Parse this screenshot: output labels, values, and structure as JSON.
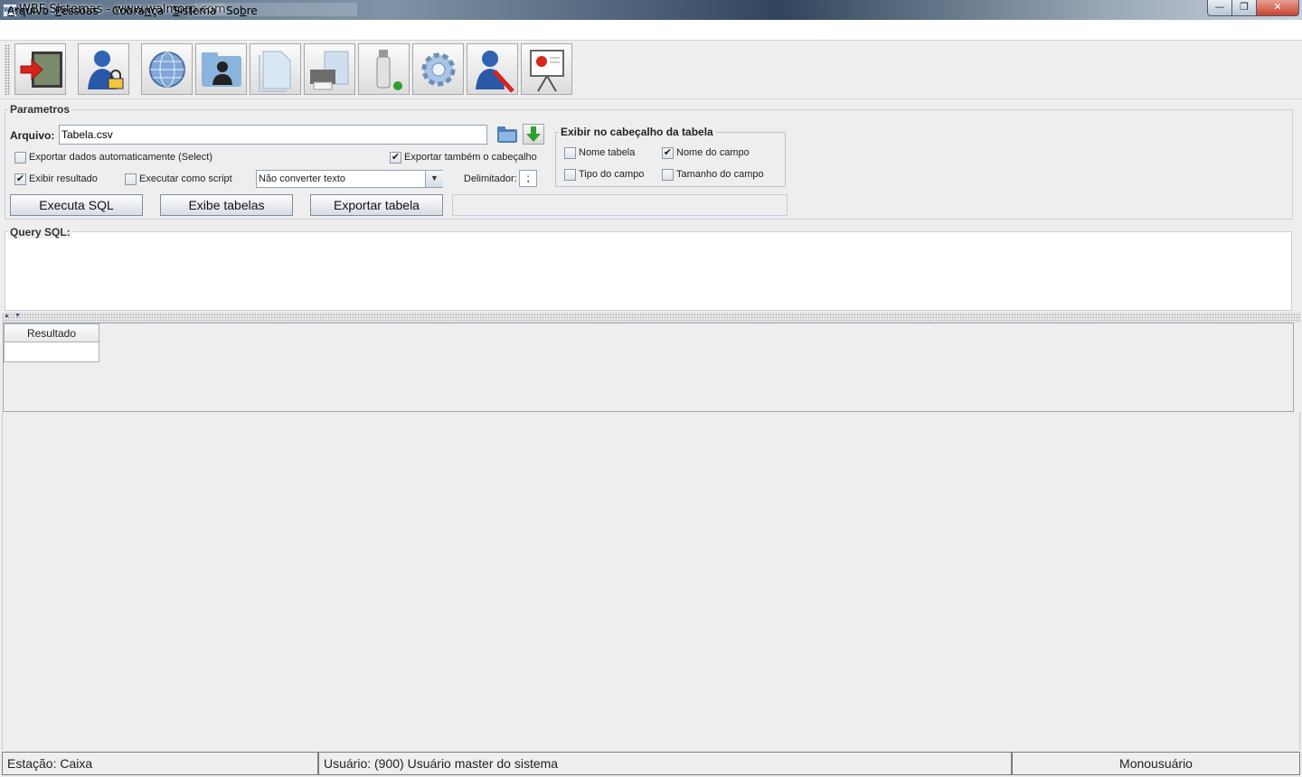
{
  "window": {
    "title": "WBF Sistemas - www.walmorp.com",
    "icon_text": "WBF",
    "minimize": "—",
    "maximize": "❐",
    "close": "✕"
  },
  "menu": [
    {
      "hot": "A",
      "rest": "rquivo"
    },
    {
      "hot": "P",
      "rest": "essoas"
    },
    {
      "pre": "Cobra",
      "hot": "n",
      "rest": "ça"
    },
    {
      "hot": "S",
      "rest": "istema"
    },
    {
      "pre": "So",
      "hot": "b",
      "rest": "re"
    }
  ],
  "toolbar": {
    "icons": [
      "exit-icon",
      "user-lock-icon",
      "globe-icon",
      "contacts-folder-icon",
      "documents-icon",
      "printer-icon",
      "usb-drive-icon",
      "settings-gear-icon",
      "user-tools-icon",
      "presentation-board-icon"
    ]
  },
  "parametros": {
    "title": "Parametros",
    "arquivo_label": "Arquivo:",
    "arquivo_value": "Tabela.csv",
    "exportar_auto": {
      "label": "Exportar dados automaticamente (Select)",
      "checked": false
    },
    "exportar_cabecalho": {
      "label": "Exportar também o cabeçalho",
      "checked": true
    },
    "exibir_resultado": {
      "label": "Exibir resultado",
      "checked": true
    },
    "executar_script": {
      "label": "Executar como script",
      "checked": false
    },
    "converter_value": "Não converter texto",
    "delimitador_label": "Delimitador:",
    "delimitador_value": ";",
    "buttons": {
      "executa_sql": "Executa SQL",
      "exibe_tabelas": "Exibe tabelas",
      "exportar_tabela": "Exportar tabela"
    }
  },
  "cabecalho": {
    "title": "Exibir no cabeçalho da tabela",
    "nome_tabela": {
      "label": "Nome tabela",
      "checked": false
    },
    "nome_campo": {
      "label": "Nome do campo",
      "checked": true
    },
    "tipo_campo": {
      "label": "Tipo do campo",
      "checked": false
    },
    "tamanho_campo": {
      "label": "Tamanho do campo",
      "checked": false
    }
  },
  "query": {
    "title": "Query SQL:",
    "text": ""
  },
  "resultado": {
    "tab_label": "Resultado"
  },
  "statusbar": {
    "estacao": "Estação: Caixa",
    "usuario": "Usuário: (900) Usuário master do sistema",
    "modo": "Monousuário"
  },
  "colors": {
    "accent_blue": "#2f64b4",
    "exit_red": "#d8241c"
  }
}
